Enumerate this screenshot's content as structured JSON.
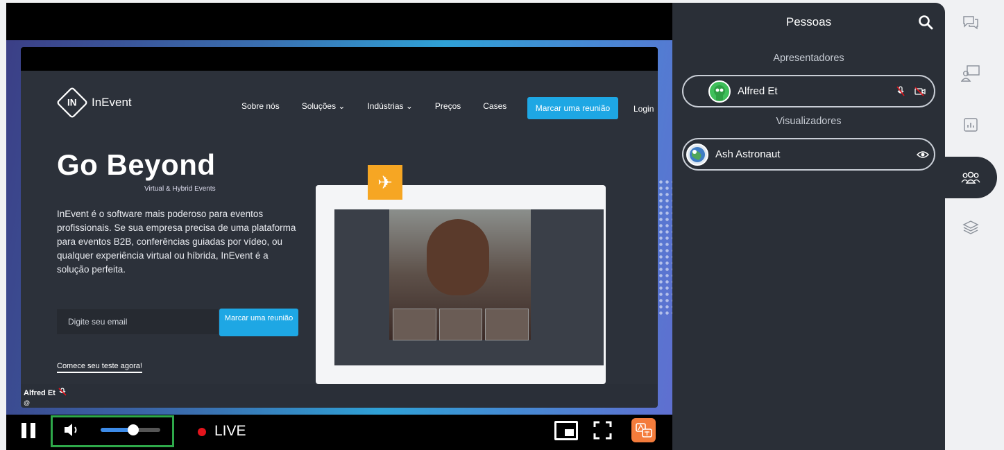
{
  "colors": {
    "panel_bg": "#2a2f37",
    "accent_blue": "#1ea7e4",
    "live_red": "#e3141c",
    "volume_highlight": "#2ea84a",
    "translate_orange": "#f47c3c"
  },
  "shared_screen": {
    "brand": "InEvent",
    "nav": [
      "Sobre nós",
      "Soluções ⌄",
      "Indústrias ⌄",
      "Preços",
      "Cases"
    ],
    "nav_cta": "Marcar uma reunião",
    "login": "Login",
    "hero_title": "Go Beyond",
    "hero_subtitle": "Virtual & Hybrid Events",
    "hero_text": "InEvent é o software mais poderoso para eventos profissionais. Se sua empresa precisa de uma plataforma para eventos B2B, conferências guiadas por vídeo, ou qualquer experiência virtual ou híbrida, InEvent é a solução perfeita.",
    "email_placeholder": "Digite seu email",
    "email_button": "Marcar uma reunião",
    "trial_link": "Comece seu teste agora!"
  },
  "speaker": {
    "name": "Alfred Et",
    "handle": "@"
  },
  "controls": {
    "live_label": "LIVE",
    "volume_level": 0.55,
    "icons": [
      "pause-icon",
      "volume-icon",
      "picture-in-picture-icon",
      "fullscreen-icon",
      "translate-icon"
    ]
  },
  "people_panel": {
    "title": "Pessoas",
    "presenters_label": "Apresentadores",
    "viewers_label": "Visualizadores",
    "presenters": [
      {
        "name": "Alfred Et",
        "icons": [
          "mic-muted-icon",
          "camera-off-icon"
        ]
      }
    ],
    "viewers": [
      {
        "name": "Ash Astronaut",
        "icons": [
          "eye-icon"
        ]
      }
    ]
  },
  "rail": {
    "items": [
      "chat-icon",
      "presenter-icon",
      "poll-icon",
      "people-icon",
      "layers-icon"
    ],
    "active": "people-icon"
  }
}
